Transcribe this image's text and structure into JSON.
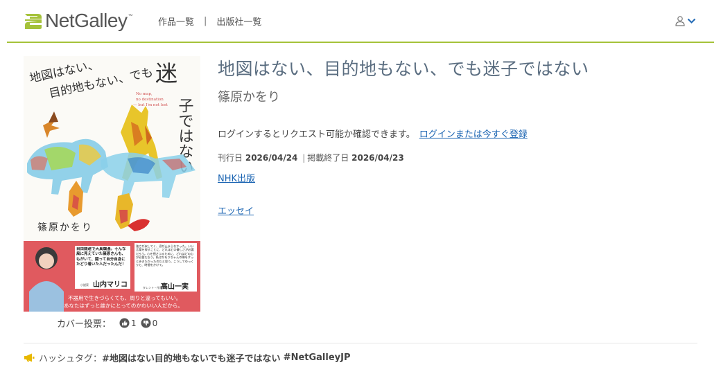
{
  "header": {
    "logo_text": "NetGalley",
    "logo_tm": "™",
    "nav": [
      {
        "label": "作品一覧"
      },
      {
        "label": "出版社一覧"
      }
    ],
    "nav_separator": "|",
    "icons": {
      "user": "user-icon",
      "dropdown": "chevron-down-icon"
    },
    "accent_color": "#a5c23a"
  },
  "book": {
    "title": "地図はない、目的地もない、でも迷子ではない",
    "author": "篠原かをり",
    "cover": {
      "title_line1": "地図はない、",
      "title_line2": "目的地もない、でも",
      "title_big": "迷",
      "title_vertical": "子ではない",
      "english_line1": "No map,",
      "english_line2": "no destination",
      "english_line3": "— but I'm not lost",
      "author": "篠原かをり",
      "blurb_left": "自由闊達で天真爛漫。そんな風に見えていた篠原さんも、もがいて、闘って自分自身にたどり着いた人だったんだ！",
      "blurb_left_name": "山内マリコ",
      "blurb_left_role": "小説家",
      "blurb_right": "強さが戻してく、涙が止まらなかった。いい言葉を探すことに、どれほどの優しさが必要だろう。心を揺さぶるために、どれほどの心が必要だろう。私はかをりちゃんの隣をずっと歩きたかったのだと思う。こうしてゆっくりと、時間をかけて。",
      "blurb_right_name": "高山一実",
      "blurb_right_role": "タレント・作家",
      "tagline_1": "不器用で生きづらくても、周りと違ってもいい。",
      "tagline_2": "あなたはずっと誰かにとってのかわいい人だから。",
      "band_color": "#e05a5f"
    },
    "cover_vote": {
      "label": "カバー投票：",
      "likes": "1",
      "dislikes": "0",
      "icons": {
        "like": "thumbs-up-icon",
        "dislike": "thumbs-down-icon"
      }
    },
    "login_prompt": "ログインするとリクエスト可能か確認できます。",
    "login_link": "ログインまたは今すぐ登録",
    "pub_date_label": "刊行日",
    "pub_date": "2026/04/24",
    "date_separator": "|",
    "end_date_label": "掲載終了日",
    "end_date": "2026/04/23",
    "publisher": "NHK出版",
    "genre": "エッセイ"
  },
  "hashtag": {
    "icon": "megaphone-icon",
    "label": "ハッシュタグ：",
    "tag_title": "#地図はない目的地もないでも迷子ではない",
    "tag_site": "#NetGalleyJP"
  },
  "colors": {
    "title": "#5a6d80",
    "link": "#1d66b3"
  }
}
